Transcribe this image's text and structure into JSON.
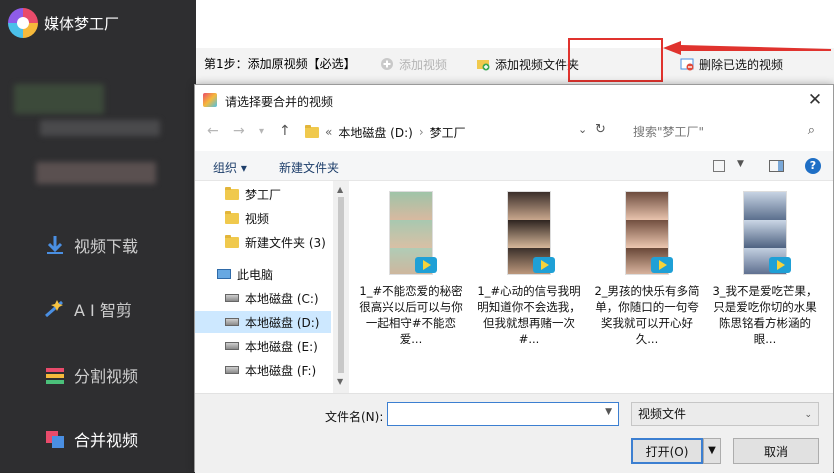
{
  "app": {
    "name": "媒体梦工厂",
    "nav": [
      {
        "label": "视频下载",
        "icon": "download-icon"
      },
      {
        "label": "A I 智剪",
        "icon": "ai-cut-icon"
      },
      {
        "label": "分割视频",
        "icon": "split-video-icon"
      },
      {
        "label": "合并视频",
        "icon": "merge-video-icon"
      }
    ]
  },
  "toolbar": {
    "step_label": "第1步：添加原视频【必选】",
    "add_video": "添加视频",
    "add_folder": "添加视频文件夹",
    "delete_selected": "删除已选的视频"
  },
  "dialog": {
    "title": "请选择要合并的视频",
    "close": "✕",
    "address": {
      "prefix": "«",
      "drive": "本地磁盘 (D:)",
      "separator": "›",
      "folder": "梦工厂"
    },
    "search_placeholder": "搜索\"梦工厂\"",
    "commands": {
      "organize": "组织 ▾",
      "new_folder": "新建文件夹"
    },
    "tree": [
      {
        "label": "梦工厂",
        "type": "folder"
      },
      {
        "label": "视频",
        "type": "folder"
      },
      {
        "label": "新建文件夹 (3)",
        "type": "folder"
      },
      {
        "label": "此电脑",
        "type": "pc"
      },
      {
        "label": "本地磁盘 (C:)",
        "type": "drive"
      },
      {
        "label": "本地磁盘 (D:)",
        "type": "drive",
        "selected": true
      },
      {
        "label": "本地磁盘 (E:)",
        "type": "drive"
      },
      {
        "label": "本地磁盘 (F:)",
        "type": "drive"
      }
    ],
    "files": [
      {
        "name": "1_#不能恋爱的秘密很高兴以后可以与你一起相守#不能恋爱..."
      },
      {
        "name": "1_#心动的信号我明明知道你不会选我，但我就想再赌一次#..."
      },
      {
        "name": "2_男孩的快乐有多简单，你随口的一句夸奖我就可以开心好久..."
      },
      {
        "name": "3_我不是爱吃芒果，只是爱吃你切的水果陈思铭看方彬涵的眼..."
      }
    ],
    "filename_label": "文件名(N):",
    "filename_value": "",
    "filetype": "视频文件",
    "open_button": "打开(O)",
    "cancel_button": "取消"
  }
}
